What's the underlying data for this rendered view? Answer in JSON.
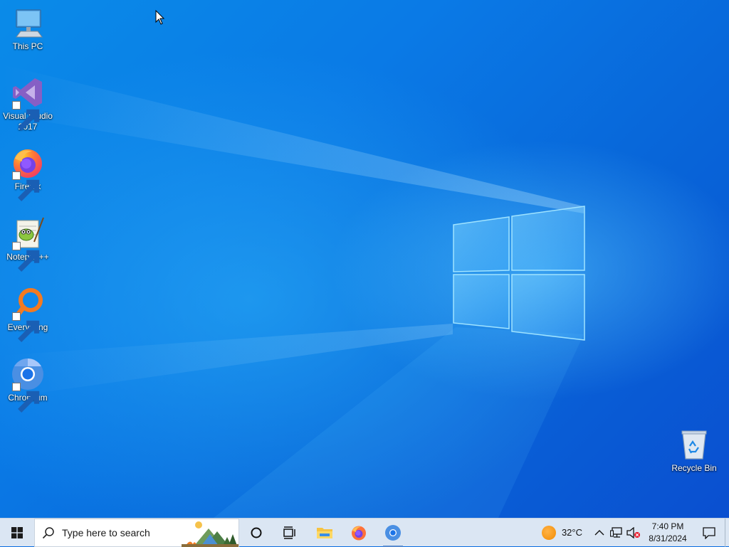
{
  "desktop": {
    "icons": [
      {
        "label": "This PC",
        "icon": "computer-icon",
        "shortcut": false
      },
      {
        "label": "Visual Studio 2017",
        "icon": "visual-studio-icon",
        "shortcut": true
      },
      {
        "label": "Firefox",
        "icon": "firefox-icon",
        "shortcut": true
      },
      {
        "label": "Notepad++",
        "icon": "notepad-plus-plus-icon",
        "shortcut": true
      },
      {
        "label": "Everything",
        "icon": "everything-search-icon",
        "shortcut": true
      },
      {
        "label": "Chromium",
        "icon": "chromium-icon",
        "shortcut": true
      },
      {
        "label": "Recycle Bin",
        "icon": "recycle-bin-icon",
        "shortcut": false
      }
    ]
  },
  "taskbar": {
    "search_placeholder": "Type here to search",
    "apps": [
      {
        "name": "cortana",
        "icon": "cortana-circle-icon",
        "running": false
      },
      {
        "name": "task-view",
        "icon": "task-view-icon",
        "running": false
      },
      {
        "name": "file-explorer",
        "icon": "folder-icon",
        "running": false
      },
      {
        "name": "firefox",
        "icon": "firefox-icon",
        "running": false
      },
      {
        "name": "chromium",
        "icon": "chromium-icon",
        "running": true
      }
    ],
    "weather": {
      "temperature": "32°C",
      "icon": "sun-icon"
    },
    "clock": {
      "time": "7:40 PM",
      "date": "8/31/2024"
    }
  },
  "colors": {
    "taskbar_bg": "#dbe6f3",
    "wallpaper_accent": "#0a7ae6",
    "volume_error": "#e81123"
  }
}
